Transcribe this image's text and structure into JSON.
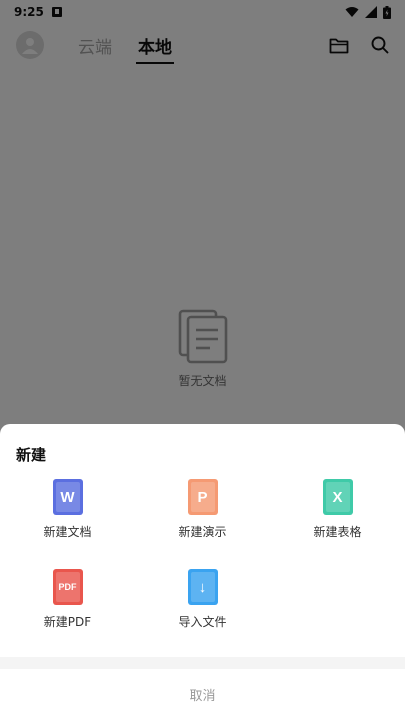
{
  "status_bar": {
    "time": "9:25"
  },
  "app_bar": {
    "tabs": [
      {
        "label": "云端",
        "active": false
      },
      {
        "label": "本地",
        "active": true
      }
    ]
  },
  "empty_state": {
    "text": "暂无文档"
  },
  "sheet": {
    "title": "新建",
    "items": [
      {
        "label": "新建文档",
        "glyph": "W",
        "color": "#5b6fe0"
      },
      {
        "label": "新建演示",
        "glyph": "P",
        "color": "#f59a73"
      },
      {
        "label": "新建表格",
        "glyph": "X",
        "color": "#3fcaa8"
      },
      {
        "label": "新建PDF",
        "glyph": "PDF",
        "color": "#e9564d"
      },
      {
        "label": "导入文件",
        "glyph": "↓",
        "color": "#3aa3f0"
      }
    ],
    "cancel_label": "取消"
  }
}
